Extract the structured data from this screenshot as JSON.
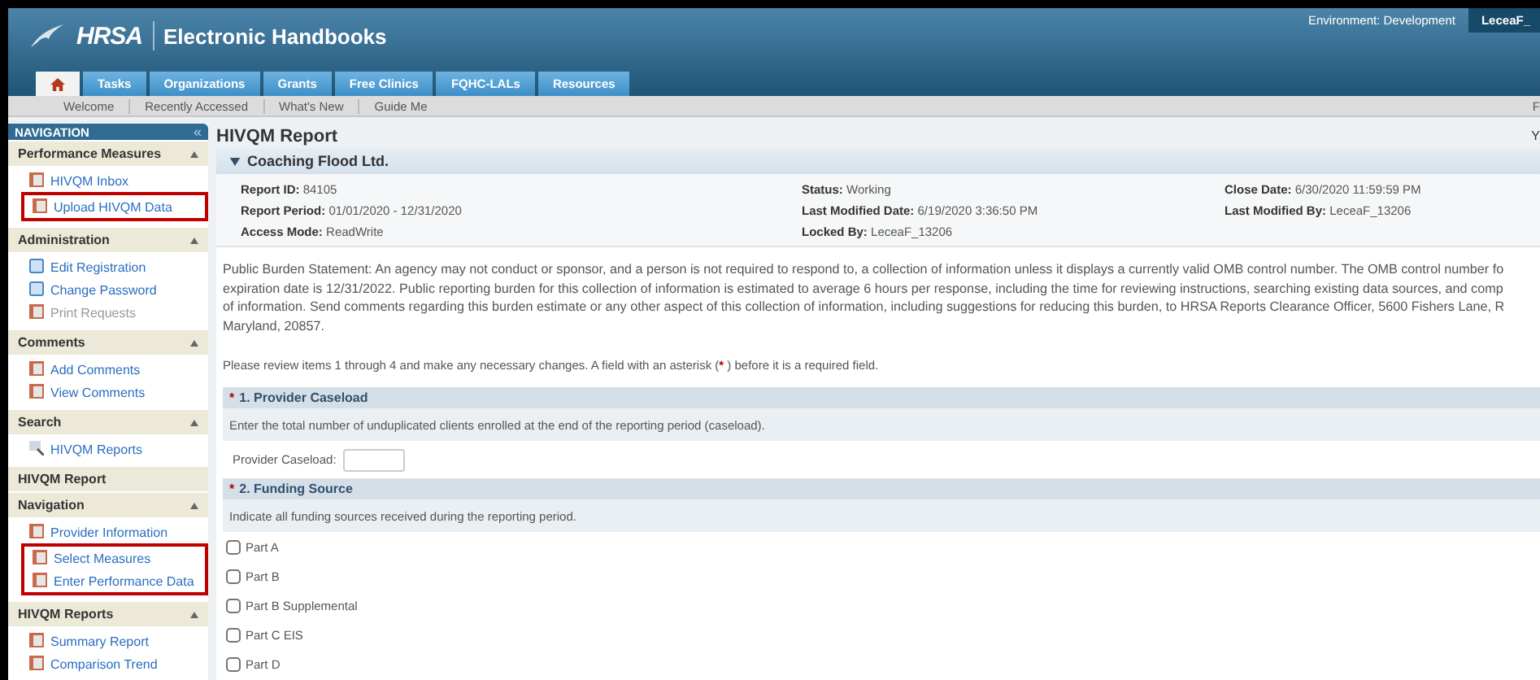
{
  "header": {
    "logo": "HRSA",
    "title": "Electronic Handbooks",
    "environment": "Environment: Development",
    "user": "LeceaF_"
  },
  "tabs": [
    {
      "kind": "home",
      "selected": true
    },
    {
      "kind": "text",
      "label": "Tasks",
      "selected": false
    },
    {
      "kind": "text",
      "label": "Organizations",
      "selected": false
    },
    {
      "kind": "text",
      "label": "Grants",
      "selected": false
    },
    {
      "kind": "text",
      "label": "Free Clinics",
      "selected": false
    },
    {
      "kind": "text",
      "label": "FQHC-LALs",
      "selected": false
    },
    {
      "kind": "text",
      "label": "Resources",
      "selected": false
    }
  ],
  "subnav": {
    "items": [
      "Welcome",
      "Recently Accessed",
      "What's New",
      "Guide Me"
    ],
    "right": "F"
  },
  "sidebar": {
    "title": "NAVIGATION",
    "collapse": "«",
    "sections": [
      {
        "title": "Performance Measures",
        "expanded": true,
        "items": [
          {
            "label": "HIVQM Inbox",
            "kind": "report",
            "disabled": false,
            "highlighted": false
          },
          {
            "label": "Upload HIVQM Data",
            "kind": "report",
            "disabled": false,
            "highlighted": true
          }
        ]
      },
      {
        "title": "Administration",
        "expanded": true,
        "items": [
          {
            "label": "Edit Registration",
            "kind": "page",
            "disabled": false,
            "highlighted": false
          },
          {
            "label": "Change Password",
            "kind": "page",
            "disabled": false,
            "highlighted": false
          },
          {
            "label": "Print Requests",
            "kind": "report",
            "disabled": true,
            "highlighted": false
          }
        ]
      },
      {
        "title": "Comments",
        "expanded": true,
        "items": [
          {
            "label": "Add Comments",
            "kind": "report",
            "disabled": false,
            "highlighted": false
          },
          {
            "label": "View Comments",
            "kind": "report",
            "disabled": false,
            "highlighted": false
          }
        ]
      },
      {
        "title": "Search",
        "expanded": true,
        "items": [
          {
            "label": "HIVQM Reports",
            "kind": "search",
            "disabled": false,
            "highlighted": false
          }
        ]
      },
      {
        "title": "HIVQM Report"
      },
      {
        "title": "Navigation",
        "expanded": true,
        "items": [
          {
            "label": "Provider Information",
            "kind": "report",
            "disabled": false,
            "highlighted": false
          },
          {
            "label": "Select Measures",
            "kind": "report",
            "disabled": false,
            "highlighted": true
          },
          {
            "label": "Enter Performance Data",
            "kind": "report",
            "disabled": false,
            "highlighted": true
          }
        ]
      },
      {
        "title": "HIVQM Reports",
        "expanded": true,
        "items": [
          {
            "label": "Summary Report",
            "kind": "report",
            "disabled": false,
            "highlighted": false
          },
          {
            "label": "Comparison Trend",
            "kind": "report",
            "disabled": false,
            "highlighted": false
          }
        ]
      }
    ]
  },
  "page": {
    "title": "HIVQM Report",
    "right": "Y",
    "organization": "Coaching Flood Ltd.",
    "expanded": true,
    "details": [
      [
        {
          "label": "Report ID:",
          "value": "84105"
        },
        {
          "label": "Report Period:",
          "value": "01/01/2020 - 12/31/2020"
        },
        {
          "label": "Access Mode:",
          "value": "ReadWrite"
        }
      ],
      [
        {
          "label": "Status:",
          "value": "Working"
        },
        {
          "label": "Last Modified Date:",
          "value": "6/19/2020 3:36:50 PM"
        },
        {
          "label": "Locked By:",
          "value": "LeceaF_13206"
        }
      ],
      [
        {
          "label": "Close Date:",
          "value": "6/30/2020 11:59:59 PM"
        },
        {
          "label": "Last Modified By:",
          "value": "LeceaF_13206"
        }
      ]
    ],
    "burden_statement": [
      "Public Burden Statement: An agency may not conduct or sponsor, and a person is not required to respond to, a collection of information unless it displays a currently valid OMB control number. The OMB control number fo",
      "expiration date is 12/31/2022. Public reporting burden for this collection of information is estimated to average 6 hours per response, including the time for reviewing instructions, searching existing data sources, and comp",
      "of information. Send comments regarding this burden estimate or any other aspect of this collection of information, including suggestions for reducing this burden, to HRSA Reports Clearance Officer, 5600 Fishers Lane, R",
      "Maryland, 20857."
    ],
    "instructions_before": "Please review items 1 through 4 and make any necessary changes. A field with an asterisk (",
    "required_mark": "*",
    "instructions_after": " ) before it is a required field.",
    "questions": [
      {
        "kind": "input",
        "required": true,
        "title": "1. Provider Caseload",
        "description": "Enter the total number of unduplicated clients enrolled at the end of the reporting period (caseload).",
        "field_label": "Provider Caseload:"
      },
      {
        "kind": "checkboxes",
        "required": true,
        "title": "2. Funding Source",
        "description": "Indicate all funding sources received during the reporting period.",
        "options": [
          {
            "label": "Part A",
            "checked": false
          },
          {
            "label": "Part B",
            "checked": false
          },
          {
            "label": "Part B Supplemental",
            "checked": false
          },
          {
            "label": "Part C EIS",
            "checked": false
          },
          {
            "label": "Part D",
            "checked": false
          }
        ]
      }
    ]
  }
}
